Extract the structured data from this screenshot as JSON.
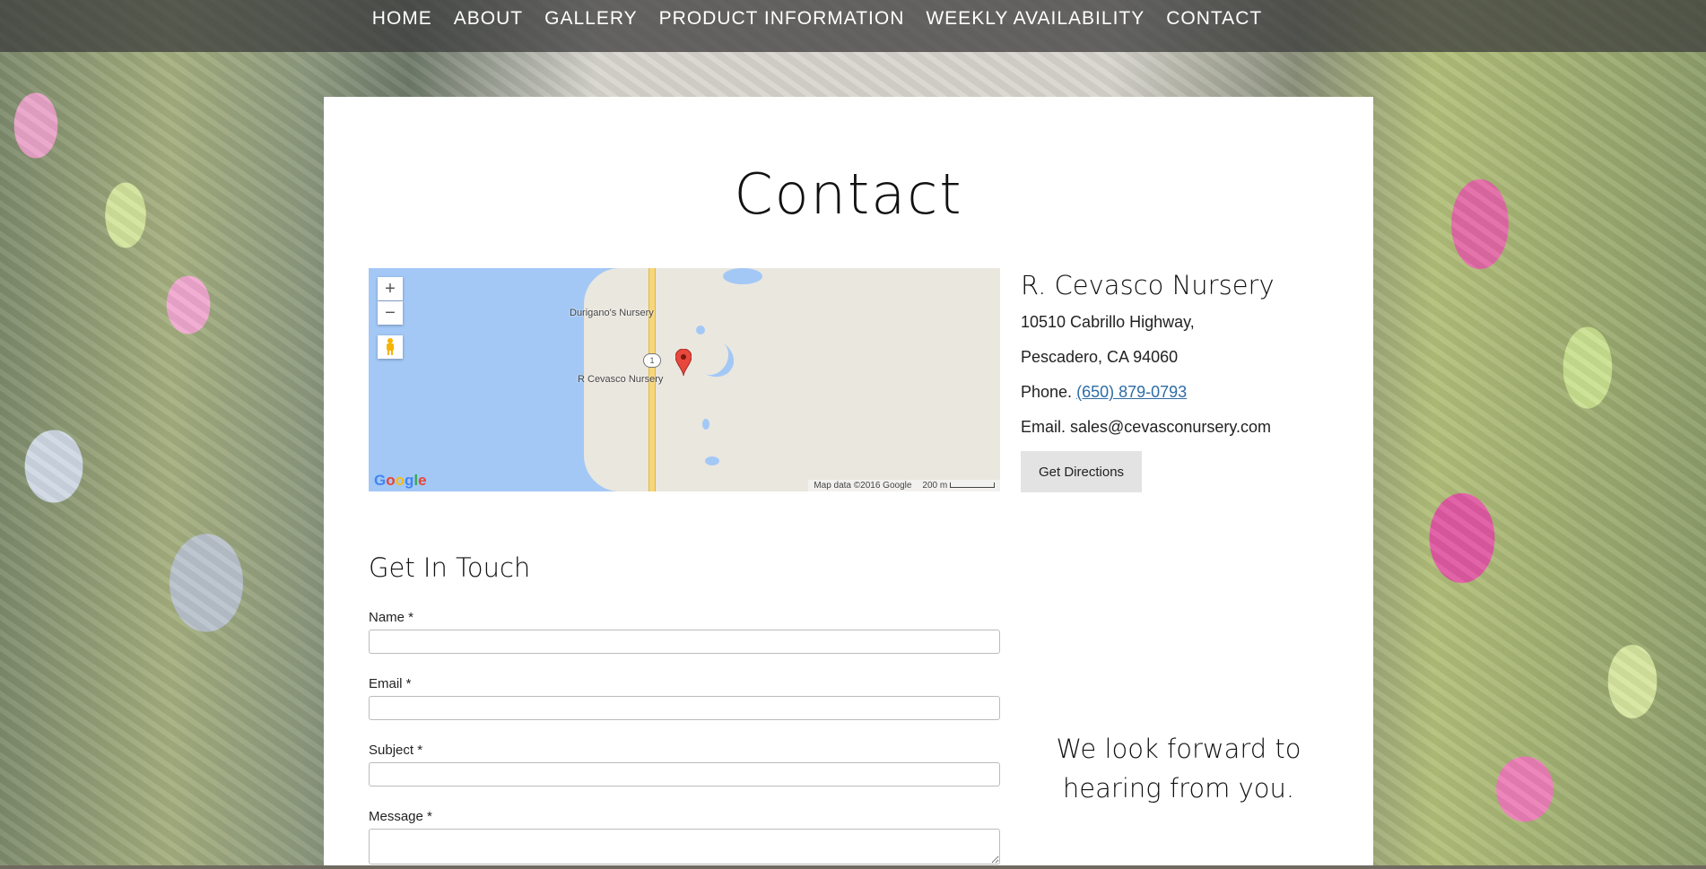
{
  "nav": {
    "items": [
      "HOME",
      "ABOUT",
      "GALLERY",
      "PRODUCT INFORMATION",
      "WEEKLY AVAILABILITY",
      "CONTACT"
    ]
  },
  "page": {
    "title": "Contact"
  },
  "map": {
    "label_nursery_north": "Durigano's Nursery",
    "label_nursery_main": "R Cevasco Nursery",
    "highway_number": "1",
    "zoom_in": "+",
    "zoom_out": "−",
    "attribution": "Map data ©2016 Google",
    "scale": "200 m",
    "logo": "Google"
  },
  "business": {
    "name": "R. Cevasco Nursery",
    "address_line1": "10510 Cabrillo Highway,",
    "address_line2": "Pescadero, CA 94060",
    "phone_prefix": "Phone.",
    "phone": "(650) 879-0793",
    "email_line": "Email. sales@cevasconursery.com",
    "directions_label": "Get Directions"
  },
  "form": {
    "title": "Get In Touch",
    "name_label": "Name *",
    "email_label": "Email *",
    "subject_label": "Subject *",
    "message_label": "Message *"
  },
  "closing": {
    "text": "We look forward to hearing from you."
  },
  "colors": {
    "nav_bg": "#3c3c3c",
    "link": "#2e6ca5",
    "button_bg": "#e3e3e3"
  }
}
